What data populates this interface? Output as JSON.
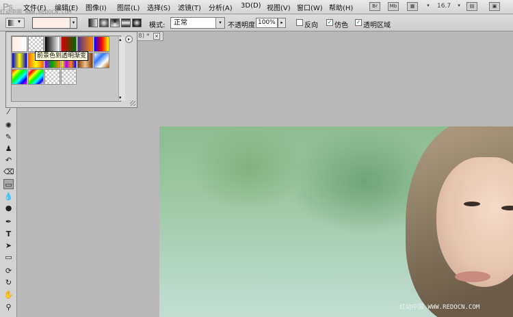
{
  "app": {
    "logo": "Ps",
    "watermark_top": "红动中国 WWW.REDOCN.COM"
  },
  "menu": [
    {
      "label": "文件(F)",
      "name": "menu-file"
    },
    {
      "label": "编辑(E)",
      "name": "menu-edit"
    },
    {
      "label": "图像(I)",
      "name": "menu-image"
    },
    {
      "label": "图层(L)",
      "name": "menu-layer"
    },
    {
      "label": "选择(S)",
      "name": "menu-select"
    },
    {
      "label": "滤镜(T)",
      "name": "menu-filter"
    },
    {
      "label": "分析(A)",
      "name": "menu-analysis"
    },
    {
      "label": "3D(D)",
      "name": "menu-3d"
    },
    {
      "label": "视图(V)",
      "name": "menu-view"
    },
    {
      "label": "窗口(W)",
      "name": "menu-window"
    },
    {
      "label": "帮助(H)",
      "name": "menu-help"
    }
  ],
  "app_bar": {
    "mb_label": "Mb",
    "zoom": "16.7"
  },
  "options": {
    "mode_label": "模式:",
    "mode_value": "正常",
    "opacity_label": "不透明度:",
    "opacity_value": "100%",
    "reverse_label": "反向",
    "dither_label": "仿色",
    "transparency_label": "透明区域",
    "reverse_checked": false,
    "dither_checked": true,
    "transparency_checked": true
  },
  "document_tab": {
    "title": "8) *"
  },
  "gradient_picker": {
    "tooltip": "前景色到透明渐变",
    "gradients": [
      "foreground-to-background",
      "foreground-to-transparent",
      "black-white",
      "red-green",
      "violet-orange",
      "blue-red-yellow",
      "blue-yellow-blue",
      "orange-yellow-orange",
      "violet-green-orange",
      "yellow-violet-orange-blue",
      "copper",
      "chrome",
      "spectrum",
      "transparent-rainbow",
      "transparent-stripes",
      "neutral-density"
    ]
  },
  "tools": [
    "eyedropper-icon",
    "spot-heal-icon",
    "brush-icon",
    "clone-stamp-icon",
    "history-brush-icon",
    "eraser-icon",
    "gradient-icon",
    "blur-icon",
    "dodge-icon",
    "pen-icon",
    "type-icon",
    "path-select-icon",
    "rectangle-icon",
    "3d-rotate-icon",
    "3d-orbit-icon",
    "hand-icon",
    "zoom-icon"
  ],
  "watermark_bottom": "红动中国 WWW.REDOCN.COM",
  "colors": {
    "menubar": "#d4d4d4",
    "canvas_bg": "#b9b9b9",
    "swatch": "#fbeee6"
  }
}
